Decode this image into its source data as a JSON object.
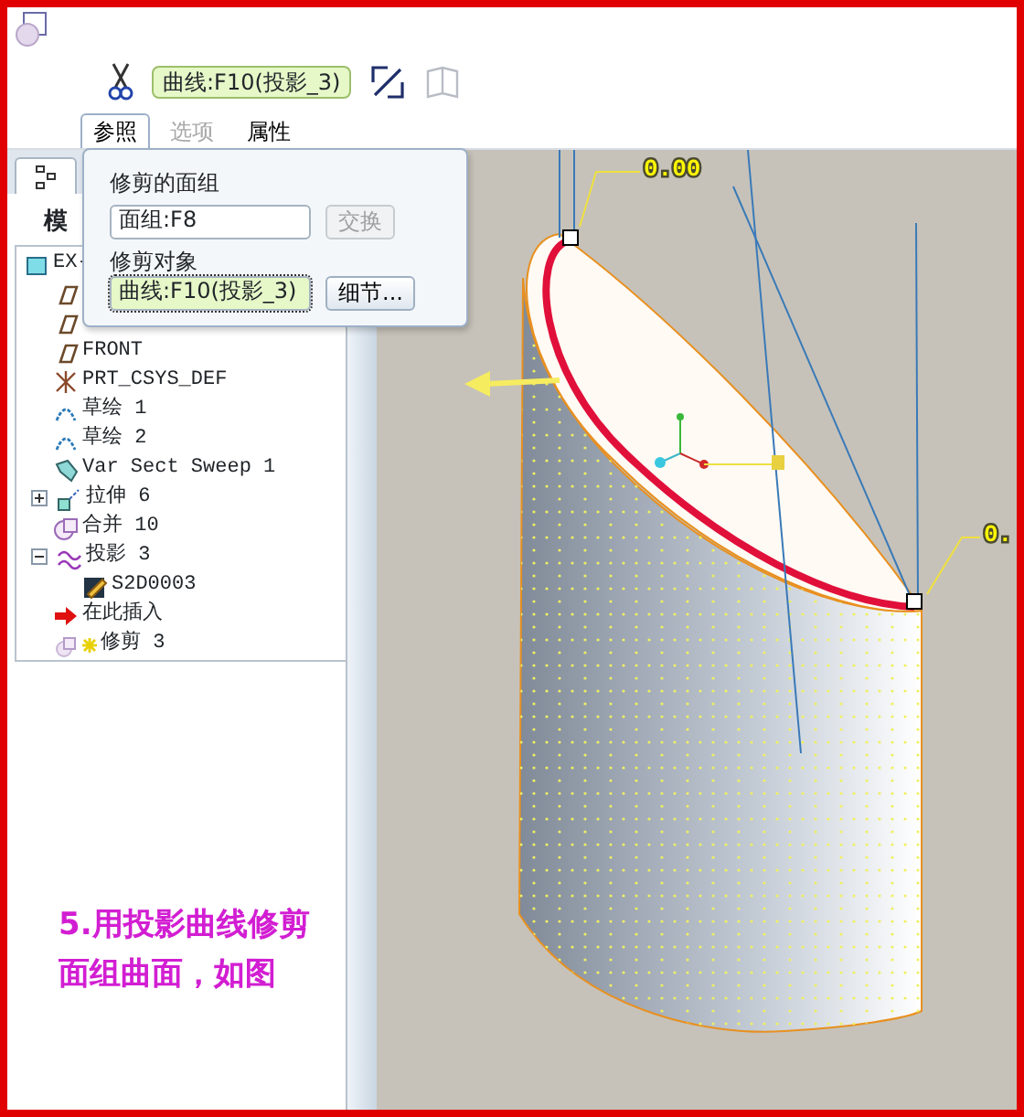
{
  "toolbar": {
    "items": [
      {
        "kind": "scissors",
        "disabled": false
      },
      {
        "kind": "chip",
        "label": "曲线:F10(投影_3)"
      },
      {
        "kind": "flip",
        "disabled": false
      },
      {
        "kind": "book",
        "disabled": true
      }
    ]
  },
  "tabs": [
    {
      "label": "参照",
      "selected": true,
      "disabled": false
    },
    {
      "label": "选项",
      "selected": false,
      "disabled": true
    },
    {
      "label": "属性",
      "selected": false,
      "disabled": false
    }
  ],
  "panel": {
    "trim_quilt_label": "修剪的面组",
    "trim_quilt_value": "面组:F8",
    "swap_button": {
      "label": "交换",
      "disabled": true
    },
    "trim_object_label": "修剪对象",
    "trim_object_value": "曲线:F10(投影_3)",
    "details_button": {
      "label": "细节...",
      "disabled": false
    }
  },
  "model_tree": {
    "heading": "模",
    "items": [
      {
        "label": "EX-",
        "kind": "part",
        "children": [
          {
            "kind": "plane"
          },
          {
            "kind": "plane"
          },
          {
            "label": "FRONT",
            "kind": "plane"
          },
          {
            "label": "PRT_CSYS_DEF",
            "kind": "csys"
          },
          {
            "label": "草绘 1",
            "kind": "sketch"
          },
          {
            "label": "草绘 2",
            "kind": "sketch"
          },
          {
            "label": "Var Sect Sweep 1",
            "kind": "sweep"
          },
          {
            "label": "拉伸 6",
            "kind": "extrude",
            "expanded": false
          },
          {
            "label": "合并 10",
            "kind": "merge"
          },
          {
            "label": "投影 3",
            "kind": "project",
            "expanded": true,
            "children": [
              {
                "label": "S2D0003",
                "kind": "pencil"
              }
            ]
          },
          {
            "label": "在此插入",
            "kind": "insert"
          },
          {
            "label": "修剪 3",
            "kind": "trim"
          }
        ]
      }
    ]
  },
  "viewport": {
    "dimension_labels": [
      "0.00",
      "0."
    ]
  },
  "caption": "5.用投影曲线修剪面组曲面，如图"
}
